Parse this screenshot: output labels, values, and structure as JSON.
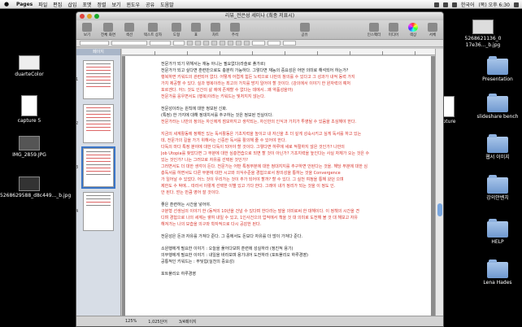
{
  "menubar": {
    "apple": "",
    "items": [
      "Pages",
      "파일",
      "편집",
      "삽입",
      "포맷",
      "정렬",
      "보기",
      "윈도우",
      "공유",
      "도움말"
    ],
    "clock": "(목) 오후 6:30",
    "lang": "한국어"
  },
  "window": {
    "title": "리뷰_전은성 세미나 (최종 저표시)",
    "toolbar": [
      {
        "label": "보기",
        "icon": "view-icon"
      },
      {
        "label": "전체 화면",
        "icon": "fullscreen-icon"
      },
      {
        "label": "섹션",
        "icon": "sections-icon"
      },
      {
        "label": "텍스트 상자",
        "icon": "textbox-icon"
      },
      {
        "label": "도형",
        "icon": "shape-icon"
      },
      {
        "label": "표",
        "icon": "table-icon"
      },
      {
        "label": "차트",
        "icon": "chart-icon"
      },
      {
        "label": "주석",
        "icon": "comment-icon"
      },
      {
        "label": "공유",
        "icon": "share-icon"
      },
      {
        "label": "인스펙터",
        "icon": "inspector-icon"
      },
      {
        "label": "미디어",
        "icon": "media-icon"
      },
      {
        "label": "색상",
        "icon": "colors-icon"
      },
      {
        "label": "서체",
        "icon": "fonts-icon"
      }
    ],
    "sidebar_header": "페이지",
    "pages": [
      "1",
      "2",
      "3",
      "4"
    ],
    "status": {
      "zoom": "125%",
      "words": "1,025단어",
      "page": "3/4페이지"
    }
  },
  "document": {
    "lines": [
      {
        "text": "전문가가 되기 위해서는 재능 아니는 필요없다(라슬로 폴가르)",
        "color": "black"
      },
      {
        "text": "전문가가 되고 싶다면 훈련만으로도 충분히 가능하다. 그렇다면 재능의 중요성은 어떤 의미로 해석되어 하는가?",
        "color": "black"
      },
      {
        "text": "행복하면 키워드의 관련되어 없다. 어떻게 어렵게 힘든 노력으로 나만의 창의를 수 있다고 그 성과가 내적 동력 가지",
        "color": "red"
      },
      {
        "text": "가치 제공할 수 있다. 실과 행복이라는 최고의 가치를 방지 일어야 할 것이다. (강의에서 이야기 한 원자력의 예처",
        "color": "red"
      },
      {
        "text": "포르겐다. 어느 것도 인간의 삶 에에 존재할 수 없다는 데에서...왜 약품성을까)",
        "color": "red"
      },
      {
        "text": "전문가를 응우면서도 (행복)이라는 키워드는 빛처지지 않는다.",
        "color": "red"
      },
      {
        "text": "",
        "color": "gap"
      },
      {
        "text": "전문성이라는 원칙에 대한 정보된 신화.",
        "color": "black"
      },
      {
        "text": "(특정) 한 가지에 대해 정대치서를 추구하는 것은 정보된 진실이다.",
        "color": "black"
      },
      {
        "text": "전문가라는 나만의 정의는 자신에게 점모하지고 생각되는, 자신만의 인식과 가치가 투영될 수 있음을 초심해야 한다.",
        "color": "red"
      },
      {
        "text": "",
        "color": "gap"
      },
      {
        "text": "지금의 세계활동에 정해진 있는 독서활동은 기초지력을 높이고 내 자신을 초 더 깊게 성숙시키고 싶게 독서를 하고 있는",
        "color": "red"
      },
      {
        "text": "데, 전문가의 길을 가기 위해서는 신중한 독서를 활의해 줄 수 있어야 한다.",
        "color": "red"
      },
      {
        "text": "다독의 마다 특정 분야에 대한 다독이 되어야 할 것이다. 그렇다면 하루에 새로 적절하지 않은 것인가? 나만의",
        "color": "red"
      },
      {
        "text": "Job Utopia를 찾았다면 그 부분에 대한 심층연습으로 되면 할 것이 아닌가? 기초지력을 높인다는 사실 자체가 오는 것은 수",
        "color": "red"
      },
      {
        "text": "있는 것인가? 나는 그러므로 자유를 선택된 것인가?",
        "color": "red"
      },
      {
        "text": "그러면서도 더 대한 생각이 든다. 전문가는 어떤 특정부분에 대한 정대지지를 추구하면 안된다는 것을. 해당 부분에 대한 심",
        "color": "red"
      },
      {
        "text": "층독서를 하면서도 다른 부분에 대한 시고와 의식수준을 경험으로서 창의성을 통하는 것을 Convergence",
        "color": "red"
      },
      {
        "text": "가 일어날 수 있었다. 어느 것이 우리가는 것이 추가 되어야 할까? 할 수 있다. 그 실천 여정을 통해 왔던 으며",
        "color": "red"
      },
      {
        "text": "제한도 수 박에... 따라서 이렇게 선택한 이별 있고 기다 한다. 그래야 내가 정리가 되는 것을 이 정도 인.",
        "color": "red"
      },
      {
        "text": "안 된다. 얻는 만큼 영어 잘 것이다.",
        "color": "red"
      },
      {
        "text": "",
        "color": "gap"
      },
      {
        "text": "좋은 훈련하는 시간을 넣어야.",
        "color": "black"
      },
      {
        "text": "구분형 선생님의 이야기 한 (동적의 10년을 건널 수 있다며 한다라는 말을 의미로써 한 대해이다. 이 정책의 시간을 견",
        "color": "red"
      },
      {
        "text": "디며 경험으로 나의 세계는 쌓여 내일 수 있고, 1인사건으의 업적에서 책을 것 대 의미로 도전해 볼 것 대 해보고 자유",
        "color": "red"
      },
      {
        "text": "해져가는 나의 모습을 의구와 학자적으로 다시 공감한 된다.",
        "color": "red"
      },
      {
        "text": "",
        "color": "gap"
      },
      {
        "text": "전문성은 돈과 자유를 가져다 준다. 그 중에서도 돈보다 자유를 더 많이 가져다 준다.",
        "color": "black"
      },
      {
        "text": "",
        "color": "gap"
      },
      {
        "text": "소원행에게 필요한 이야기 : 오늘을 풀어다보며 훈련에 성실하라 (정진적 용기)",
        "color": "black"
      },
      {
        "text": "의무행에게 필요한 이야기 : 내일을 바라보며 용기내어 도전하라 (포트폴리오 하루경영)",
        "color": "black"
      },
      {
        "text": "공통적인 키워드는 : 부딪힘(실천의 중요성)",
        "color": "black"
      },
      {
        "text": "",
        "color": "gap"
      },
      {
        "text": "포트폴리오 하루경영",
        "color": "black"
      }
    ]
  },
  "desktop_left": [
    {
      "label": "duarteColor"
    },
    {
      "label": "capture 5"
    },
    {
      "label": "IMG_2859.JPG"
    },
    {
      "label": "5268629588_d8c449..._b.jpg"
    }
  ],
  "desktop_right": [
    {
      "label": "5268621136_0 17e36..._b.jpg"
    },
    {
      "label": "Presentation"
    },
    {
      "label": "capture"
    },
    {
      "label": "slideshare bench"
    },
    {
      "label": "웹서 이미지"
    },
    {
      "label": "강의안벤치"
    },
    {
      "label": "HELP"
    },
    {
      "label": "Lena Hades"
    }
  ]
}
